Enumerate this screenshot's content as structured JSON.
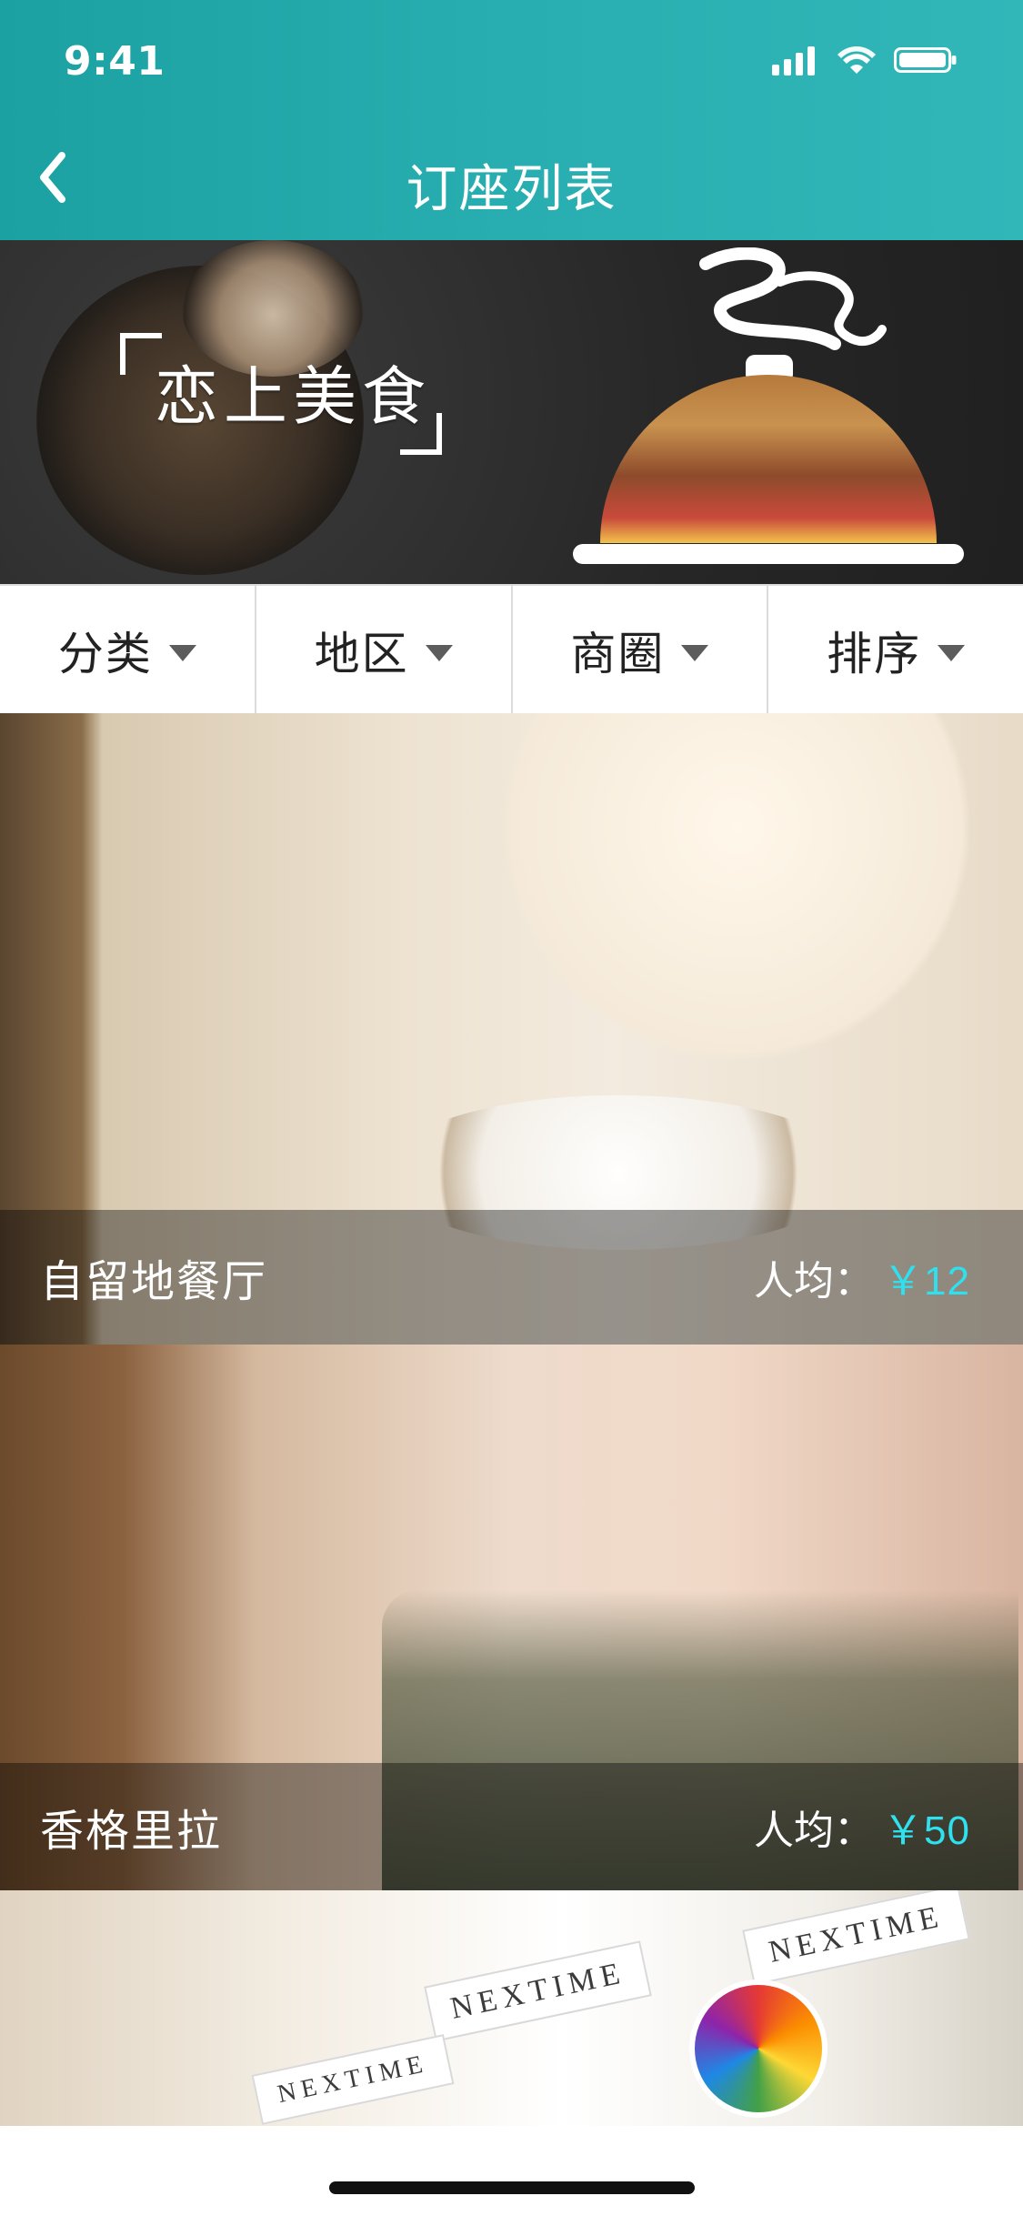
{
  "status_bar": {
    "time": "9:41",
    "icons": [
      "signal-icon",
      "wifi-icon",
      "battery-icon"
    ]
  },
  "nav": {
    "title": "订座列表",
    "back_icon": "chevron-left-icon"
  },
  "banner": {
    "title": "恋上美食"
  },
  "filters": [
    {
      "label": "分类",
      "icon": "caret-down-icon"
    },
    {
      "label": "地区",
      "icon": "caret-down-icon"
    },
    {
      "label": "商圈",
      "icon": "caret-down-icon"
    },
    {
      "label": "排序",
      "icon": "caret-down-icon"
    }
  ],
  "restaurants": [
    {
      "name": "自留地餐厅",
      "price_label": "人均：",
      "price_value": "￥12"
    },
    {
      "name": "香格里拉",
      "price_label": "人均：",
      "price_value": "￥50"
    }
  ],
  "decor": {
    "nextime_sign_1": "NEXTIME",
    "nextime_sign_2": "NEXTIME",
    "nextime_sign_3": "NEXTIME"
  },
  "colors": {
    "header_teal": "#28aeb0",
    "price_cyan": "#2fe0ef",
    "overlay": "rgba(0,0,0,0.38)"
  }
}
